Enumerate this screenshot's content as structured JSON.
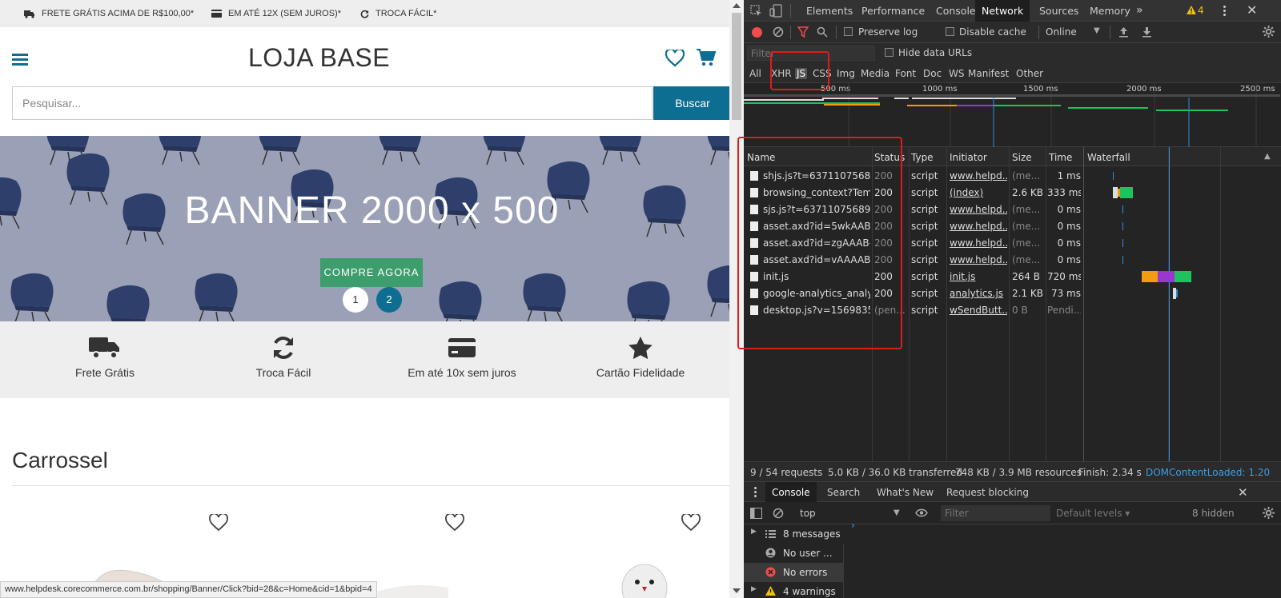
{
  "store": {
    "topbar": {
      "shipping": "FRETE GRÁTIS ACIMA DE R$100,00*",
      "installments": "EM ATÉ 12X (SEM JUROS)*",
      "exchange": "TROCA FÁCIL*"
    },
    "logo": "LOJA BASE",
    "search": {
      "placeholder": "Pesquisar...",
      "button": "Buscar"
    },
    "banner": {
      "title": "BANNER 2000 x 500",
      "cta": "COMPRE AGORA",
      "dots": [
        "1",
        "2"
      ],
      "active_dot": "2"
    },
    "features": [
      {
        "icon": "truck-icon",
        "label": "Frete Grátis"
      },
      {
        "icon": "refresh-icon",
        "label": "Troca Fácil"
      },
      {
        "icon": "credit-card-icon",
        "label": "Em até 10x sem juros"
      },
      {
        "icon": "star-icon",
        "label": "Cartão Fidelidade"
      }
    ],
    "section_title": "Carrossel",
    "status_url": "www.helpdesk.corecommerce.com.br/shopping/Banner/Click?bid=28&c=Home&cid=1&bpid=4"
  },
  "devtools": {
    "tabs": [
      "Elements",
      "Performance",
      "Console",
      "Network",
      "Sources",
      "Memory"
    ],
    "active_tab": "Network",
    "more": "»",
    "warnings_count": "4",
    "toolbar": {
      "preserve_log": "Preserve log",
      "disable_cache": "Disable cache",
      "throttle": "Online"
    },
    "filter": {
      "placeholder": "Filter",
      "hide_data_urls": "Hide data URLs"
    },
    "types": [
      "All",
      "XHR",
      "JS",
      "CSS",
      "Img",
      "Media",
      "Font",
      "Doc",
      "WS",
      "Manifest",
      "Other"
    ],
    "active_type": "JS",
    "timeline_ticks": [
      "500 ms",
      "1000 ms",
      "1500 ms",
      "2000 ms",
      "2500 ms"
    ],
    "columns": [
      "Name",
      "Status",
      "Type",
      "Initiator",
      "Size",
      "Time",
      "Waterfall"
    ],
    "requests": [
      {
        "name": "shjs.js?t=63711075689...",
        "status": "200",
        "type": "script",
        "initiator": "www.helpd...",
        "size": "(me...",
        "time": "1 ms",
        "dim": true
      },
      {
        "name": "browsing_context?Tem...",
        "status": "200",
        "type": "script",
        "initiator": "(index)",
        "size": "2.6 KB",
        "time": "333 ms",
        "dim": false
      },
      {
        "name": "sjs.js?t=637110756892...",
        "status": "200",
        "type": "script",
        "initiator": "www.helpd...",
        "size": "(me...",
        "time": "0 ms",
        "dim": true
      },
      {
        "name": "asset.axd?id=5wkAAB-L...",
        "status": "200",
        "type": "script",
        "initiator": "www.helpd...",
        "size": "(me...",
        "time": "0 ms",
        "dim": true
      },
      {
        "name": "asset.axd?id=zgAAAB-L...",
        "status": "200",
        "type": "script",
        "initiator": "www.helpd...",
        "size": "(me...",
        "time": "0 ms",
        "dim": true
      },
      {
        "name": "asset.axd?id=vAAAAB-L...",
        "status": "200",
        "type": "script",
        "initiator": "www.helpd...",
        "size": "(me...",
        "time": "0 ms",
        "dim": true
      },
      {
        "name": "init.js",
        "status": "200",
        "type": "script",
        "initiator": "init.js",
        "size": "264 B",
        "time": "720 ms",
        "dim": false
      },
      {
        "name": "google-analytics_analyt...",
        "status": "200",
        "type": "script",
        "initiator": "analytics.js",
        "size": "2.1 KB",
        "time": "73 ms",
        "dim": false
      },
      {
        "name": "desktop.js?v=15698352...",
        "status": "(pen...",
        "type": "script",
        "initiator": "wSendButt...",
        "size": "0 B",
        "time": "Pendi...",
        "dim": true
      }
    ],
    "summary": {
      "requests": "9 / 54 requests",
      "transferred": "5.0 KB / 36.0 KB transferred",
      "resources": "748 KB / 3.9 MB resources",
      "finish": "Finish: 2.34 s",
      "dcl": "DOMContentLoaded: 1.20"
    },
    "drawer": {
      "tabs": [
        "Console",
        "Search",
        "What's New",
        "Request blocking"
      ],
      "active": "Console",
      "context": "top",
      "filter_placeholder": "Filter",
      "levels": "Default levels ▾",
      "hidden": "8 hidden",
      "sidebar": [
        "8 messages",
        "No user ...",
        "No errors",
        "4 warnings"
      ]
    }
  }
}
